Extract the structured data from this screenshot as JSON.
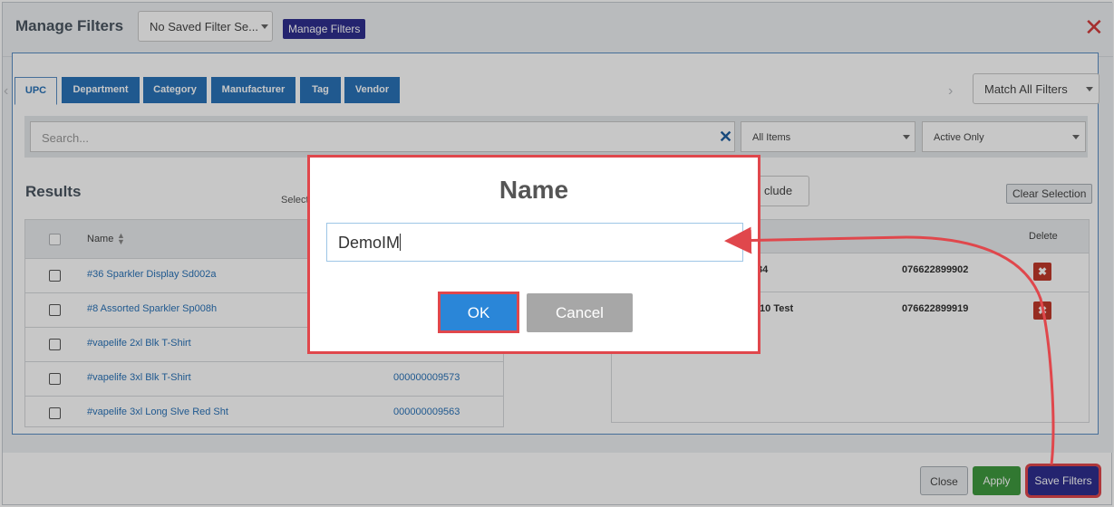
{
  "header": {
    "title": "Manage Filters",
    "saved_filter_select": "No Saved Filter Se...",
    "manage_filters_button": "Manage Filters"
  },
  "tabs": [
    "UPC",
    "Department",
    "Category",
    "Manufacturer",
    "Tag",
    "Vendor"
  ],
  "match_select": "Match All Filters",
  "search": {
    "placeholder": "Search...",
    "items_filter": "All Items",
    "status_filter": "Active Only"
  },
  "results": {
    "title": "Results",
    "select_label": "Select",
    "name_header": "Name",
    "rows": [
      {
        "name": "#36 Sparkler Display Sd002a",
        "upc": ""
      },
      {
        "name": "#8 Assorted Sparkler Sp008h",
        "upc": ""
      },
      {
        "name": "#vapelife 2xl Blk T-Shirt",
        "upc": ""
      },
      {
        "name": "#vapelife 3xl Blk T-Shirt",
        "upc": "000000009573"
      },
      {
        "name": "#vapelife 3xl Long Slve Red Sht",
        "upc": "000000009563"
      }
    ]
  },
  "selection": {
    "include_button": "clude",
    "clear_selection_button": "Clear Selection",
    "delete_header": "Delete",
    "rows": [
      {
        "name": "34",
        "upc": "076622899902"
      },
      {
        "name": "/10 Test",
        "upc": "076622899919"
      }
    ]
  },
  "footer": {
    "close_button": "Close",
    "apply_button": "Apply",
    "save_filters_button": "Save Filters"
  },
  "modal": {
    "title": "Name",
    "input_value": "DemoIM",
    "ok_button": "OK",
    "cancel_button": "Cancel"
  },
  "colors": {
    "primary_blue": "#2a73b8",
    "indigo": "#2f2f8f",
    "apply_green": "#3f9a3f",
    "highlight_red": "#e0474c"
  }
}
